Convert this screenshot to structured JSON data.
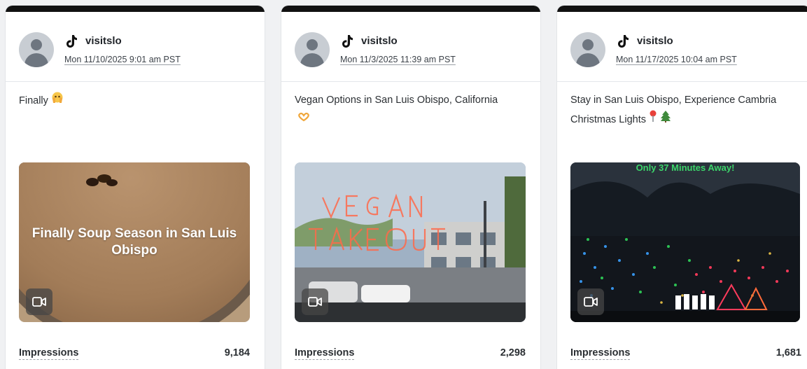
{
  "posts": [
    {
      "username": "visitslo",
      "timestamp": "Mon 11/10/2025 9:01 am PST",
      "caption": "Finally",
      "caption_emoji": "face-holding-back-tears",
      "media_overlay_text": "Finally Soup Season in San Luis Obispo",
      "media_type": "video",
      "metric_label": "Impressions",
      "metric_value": "9,184"
    },
    {
      "username": "visitslo",
      "timestamp": "Mon 11/3/2025 11:39 am PST",
      "caption": "Vegan Options in San Luis Obispo, California",
      "caption_emoji": "heart-hands",
      "media_overlay_text": "",
      "media_type": "video",
      "metric_label": "Impressions",
      "metric_value": "2,298"
    },
    {
      "username": "visitslo",
      "timestamp": "Mon 11/17/2025 10:04 am PST",
      "caption": "Stay in San Luis Obispo, Experience Cambria Christmas Lights",
      "caption_emoji": "round-pushpin, christmas-tree",
      "media_overlay_text": "Only 37 Minutes Away!",
      "media_type": "video",
      "metric_label": "Impressions",
      "metric_value": "1,681"
    }
  ],
  "platform_icon": "tiktok-icon",
  "colors": {
    "card_top_bar": "#111111",
    "avatar_bg": "#c8cdd3",
    "banner_green": "#3cd46a"
  }
}
